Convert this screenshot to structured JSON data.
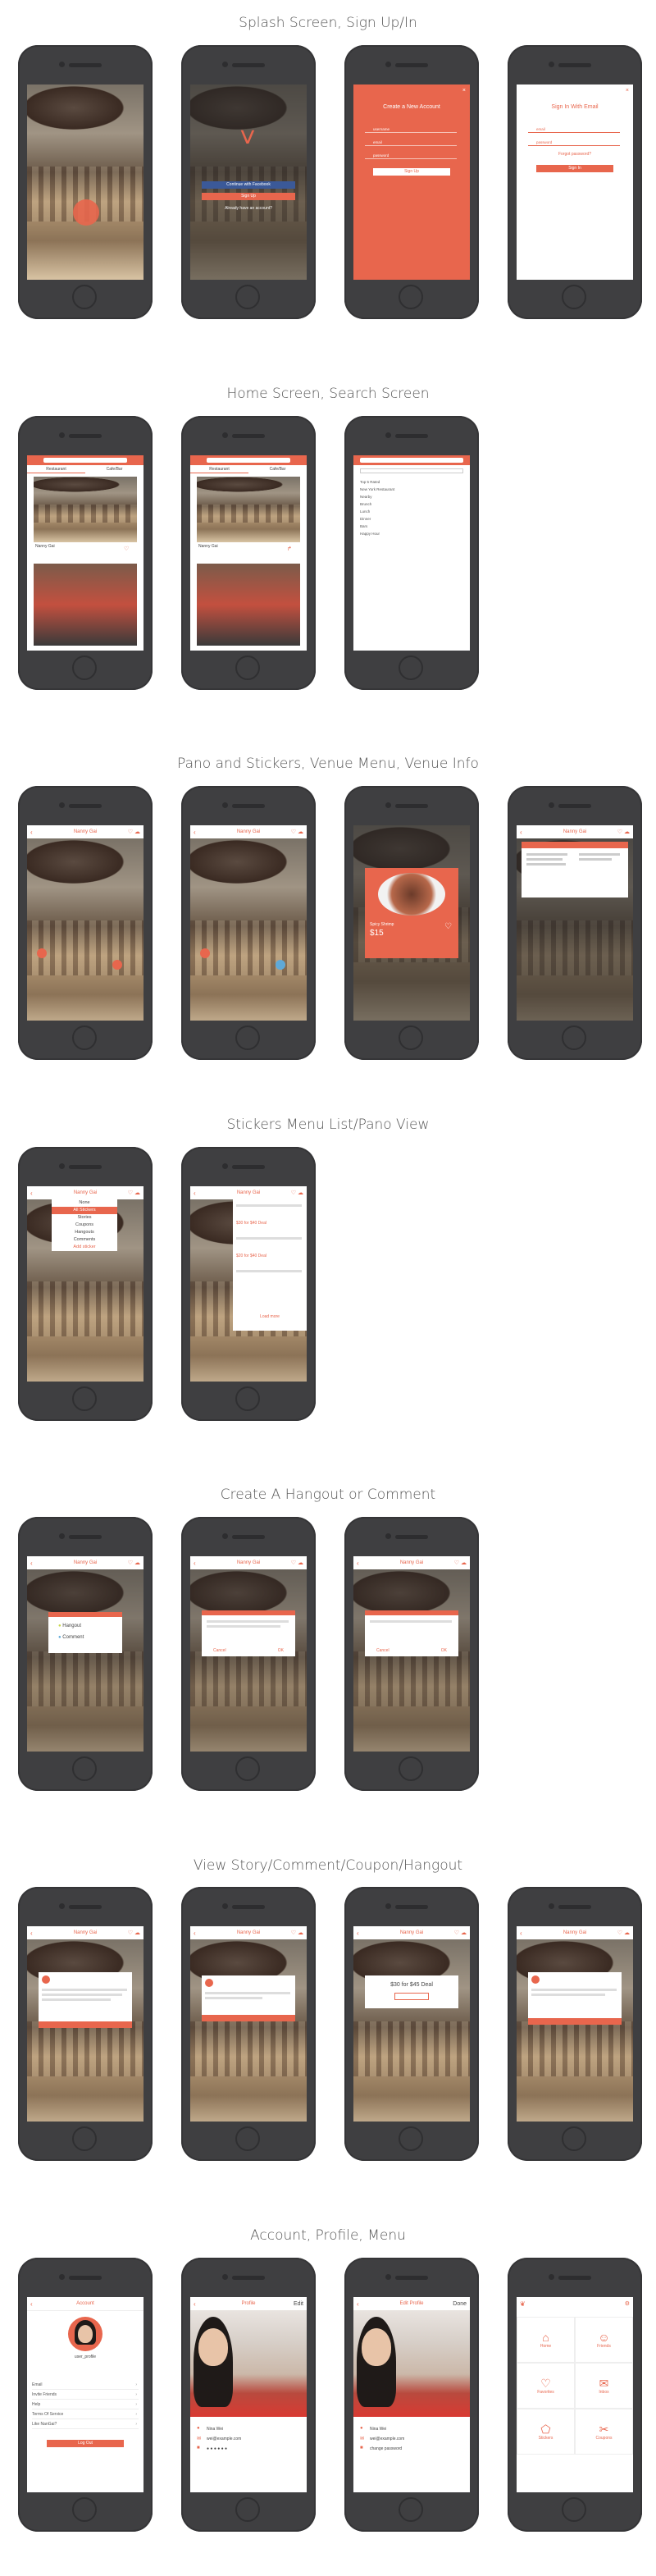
{
  "sections": [
    {
      "title": "Splash Screen, Sign Up/In"
    },
    {
      "title": "Home Screen, Search Screen"
    },
    {
      "title": "Pano and Stickers, Venue Menu, Venue Info"
    },
    {
      "title": "Stickers Menu List/Pano View"
    },
    {
      "title": "Create A Hangout or Comment"
    },
    {
      "title": "View Story/Comment/Coupon/Hangout"
    },
    {
      "title": "Account, Profile, Menu"
    }
  ],
  "splash": {
    "facebook_btn": "Continue with Facebook",
    "signup_btn": "Sign Up",
    "already": "Already have an account?"
  },
  "create_account": {
    "title": "Create a New Account",
    "username": "username",
    "email": "email",
    "password": "password",
    "submit": "Sign Up"
  },
  "sign_in": {
    "title": "Sign In With Email",
    "email": "email",
    "password": "password",
    "forgot": "Forgot password?",
    "submit": "Sign In"
  },
  "home": {
    "tab1": "Restaurant",
    "tab2": "Cafe/Bar",
    "venue": "Nanny Gai"
  },
  "search": {
    "items": [
      "Top 5 Rated",
      "New York Restaurant",
      "Nearby",
      "Brunch",
      "Lunch",
      "Dinner",
      "Bars",
      "Happy Hour"
    ]
  },
  "venue": {
    "name": "Nanny Gai",
    "dish_name": "Spicy Shrimp",
    "dish_price": "$15"
  },
  "stickers_menu": {
    "items": [
      "None",
      "All Stickers",
      "Stories",
      "Coupons",
      "Hangouts",
      "Comments"
    ],
    "active": "All Stickers",
    "add": "Add sticker"
  },
  "sticker_list": {
    "items": [
      "$30 for $40 Deal",
      "$20 for $40 Deal"
    ],
    "more": "Load more"
  },
  "create": {
    "hangout": "Hangout",
    "comment": "Comment",
    "cancel": "Cancel",
    "ok": "OK"
  },
  "view": {
    "coupon": "$30 for $45 Deal"
  },
  "account": {
    "title": "Account",
    "username": "user_profile",
    "rows": [
      "Email",
      "Invite Friends",
      "Help",
      "Terms Of Service",
      "Like NanGai?"
    ],
    "logout": "Log Out"
  },
  "profile": {
    "title": "Profile",
    "edit": "Edit",
    "name": "Nina Wei",
    "email": "wei@example.com",
    "password": "● ● ● ● ● ●"
  },
  "edit_profile": {
    "title": "Edit Profile",
    "done": "Done",
    "name": "Nina Wei",
    "email": "wei@example.com",
    "change_pw": "change password"
  },
  "menu": {
    "tiles": [
      "Home",
      "Friends",
      "Favorites",
      "Inbox",
      "Stickers",
      "Coupons"
    ]
  },
  "colors": {
    "accent": "#e8664d",
    "phone": "#3f3f41"
  }
}
